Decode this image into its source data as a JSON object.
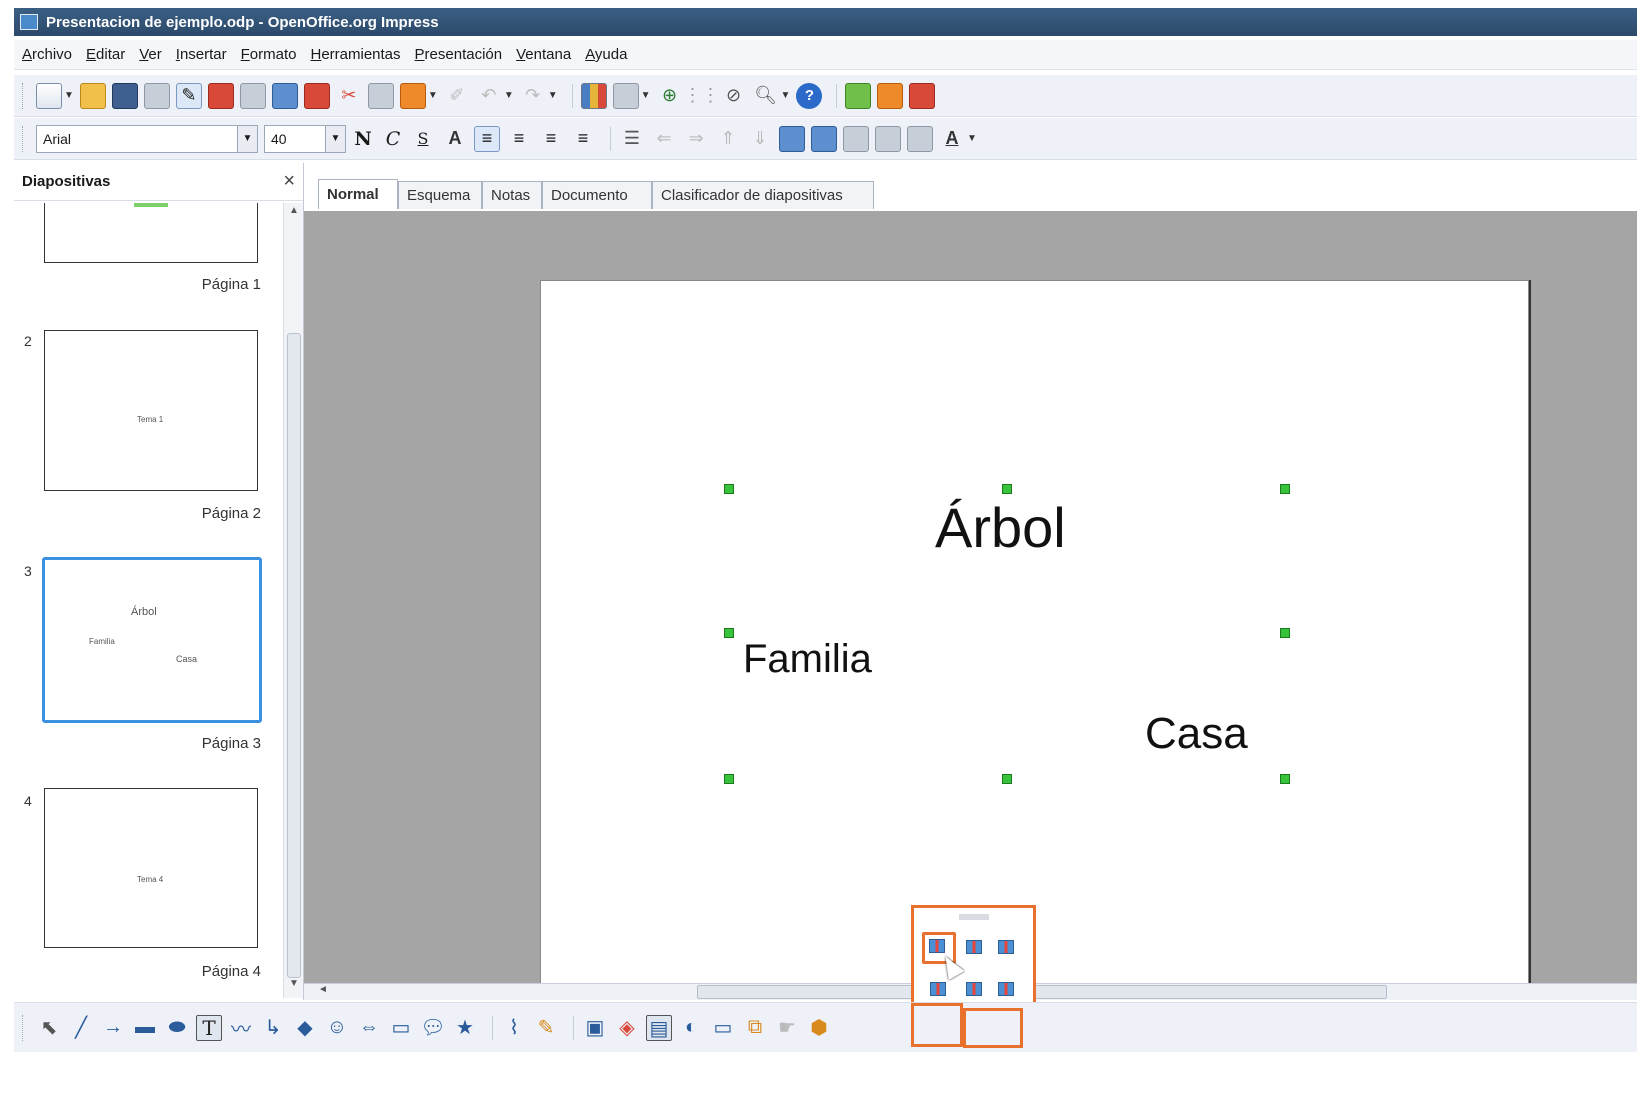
{
  "window": {
    "title": "Presentacion de ejemplo.odp - OpenOffice.org Impress"
  },
  "menu": [
    "Archivo",
    "Editar",
    "Ver",
    "Insertar",
    "Formato",
    "Herramientas",
    "Presentación",
    "Ventana",
    "Ayuda"
  ],
  "format_toolbar": {
    "font_name": "Arial",
    "font_size": "40",
    "bold_label": "N",
    "italic_label": "C",
    "underline_label": "S"
  },
  "slides_panel": {
    "title": "Diapositivas",
    "close_label": "×",
    "slides": [
      {
        "number": "",
        "page_label": "Página 1",
        "selected": false,
        "thumb_texts": []
      },
      {
        "number": "2",
        "page_label": "Página 2",
        "selected": false,
        "thumb_texts": [
          "Tema 1"
        ]
      },
      {
        "number": "3",
        "page_label": "Página 3",
        "selected": true,
        "thumb_texts": [
          "Árbol",
          "Familia",
          "Casa"
        ]
      },
      {
        "number": "4",
        "page_label": "Página 4",
        "selected": false,
        "thumb_texts": [
          "Tema 4"
        ]
      }
    ]
  },
  "view_tabs": [
    "Normal",
    "Esquema",
    "Notas",
    "Documento",
    "Clasificador de diapositivas"
  ],
  "active_tab": "Normal",
  "slide": {
    "word_top": "Árbol",
    "word_left": "Familia",
    "word_right": "Casa"
  },
  "colors": {
    "highlight": "#e8722d",
    "selection": "#3a91e0",
    "handle": "#38c43a",
    "workspace": "#a5a5a5"
  }
}
